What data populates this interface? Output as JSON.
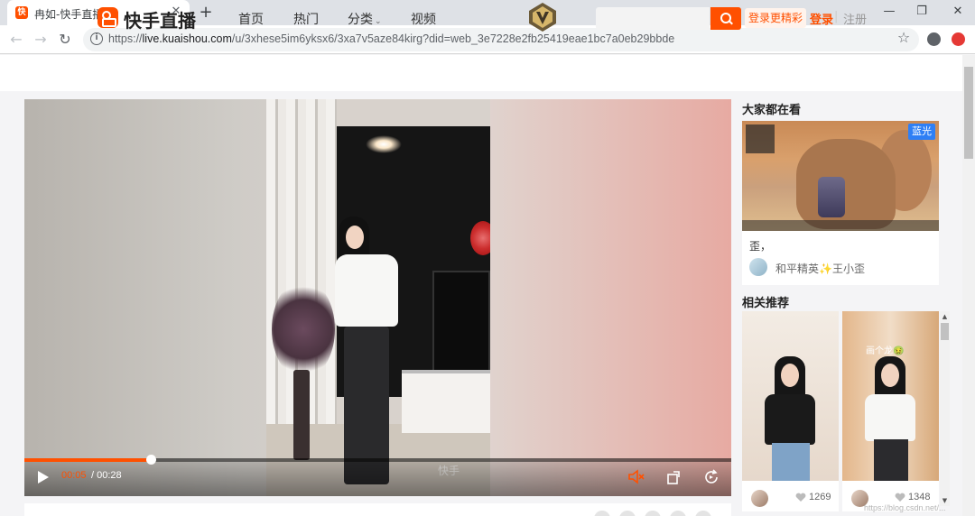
{
  "browser": {
    "tab_title": "冉如-快手直播",
    "tab_close": "✕",
    "new_tab": "+",
    "window_min": "—",
    "window_max": "❐",
    "window_close": "✕",
    "url_scheme": "https://",
    "url_host": "live.kuaishou.com",
    "url_path": "/u/3xhese5im6yksx6/3xa7v5aze84kirg?did=web_3e7228e2fb25419eae1bc7a0eb29bbde"
  },
  "header": {
    "logo_text": "快手直播",
    "nav": {
      "home": "首页",
      "hot": "热门",
      "category": "分类",
      "video": "视频"
    },
    "login_tip": "登录更精彩",
    "login": "登录",
    "separator": "|",
    "register": "注册"
  },
  "player": {
    "current_time": "00:05",
    "total_time": "/ 00:28",
    "progress": 0.179,
    "buffered": 0.85,
    "watermark": "快手",
    "accent": "#ff5000"
  },
  "sidebar": {
    "watching_title": "大家都在看",
    "live_card": {
      "badge": "蓝光",
      "caption": "歪，",
      "streamer": "和平精英✨王小歪"
    },
    "related_title": "相关推荐",
    "recommendations": [
      {
        "overlay": "",
        "likes": "1269"
      },
      {
        "overlay": "画个龙🤢",
        "likes": "1348"
      }
    ],
    "scroll_up": "▲",
    "scroll_down": "▼"
  },
  "watermark_text": "https://blog.csdn.net/..."
}
